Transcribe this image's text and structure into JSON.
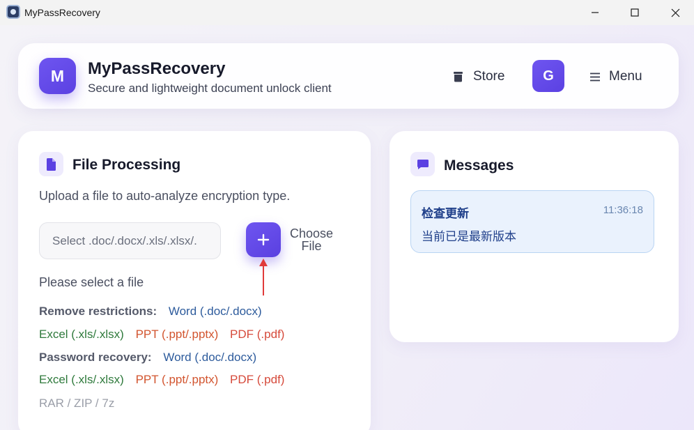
{
  "window": {
    "title": "MyPassRecovery",
    "controls": [
      "minimize-icon",
      "maximize-icon",
      "close-icon"
    ]
  },
  "header": {
    "logo_letter": "M",
    "title": "MyPassRecovery",
    "subtitle": "Secure and lightweight document unlock client",
    "store_label": "Store",
    "store_icon": "store-icon",
    "avatar_letter": "G",
    "menu_label": "Menu",
    "menu_icon": "hamburger-icon"
  },
  "file_processing": {
    "icon": "document-icon",
    "title": "File Processing",
    "hint": "Upload a file to auto-analyze encryption type.",
    "input_placeholder": "Select .doc/.docx/.xls/.xlsx/.",
    "choose_label_line1": "Choose",
    "choose_label_line2": "File",
    "status": "Please select a file",
    "remove_restrictions": {
      "label": "Remove restrictions:",
      "word": "Word (.doc/.docx)",
      "excel": "Excel (.xls/.xlsx)",
      "ppt": "PPT (.ppt/.pptx)",
      "pdf": "PDF (.pdf)"
    },
    "password_recovery": {
      "label": "Password recovery:",
      "word": "Word (.doc/.docx)",
      "excel": "Excel (.xls/.xlsx)",
      "ppt": "PPT (.ppt/.pptx)",
      "pdf": "PDF (.pdf)",
      "archive": "RAR / ZIP / 7z"
    }
  },
  "messages": {
    "icon": "chat-icon",
    "title": "Messages",
    "items": [
      {
        "title": "检查更新",
        "time": "11:36:18",
        "body": "当前已是最新版本"
      }
    ]
  },
  "colors": {
    "accent": "#6a4ff0",
    "word": "#2d5b9c",
    "excel": "#2f7a3c",
    "ppt": "#d2542e",
    "pdf": "#d64a3b",
    "message_bg": "#eaf2fd"
  }
}
